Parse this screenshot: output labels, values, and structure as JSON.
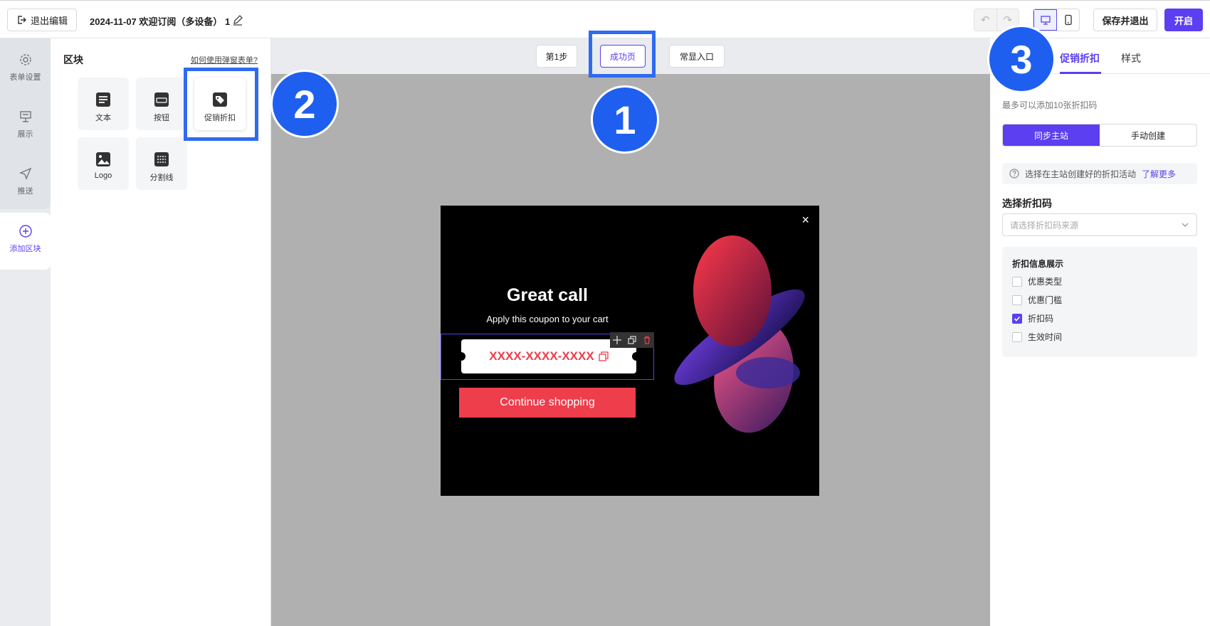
{
  "topbar": {
    "exit_label": "退出编辑",
    "doc_title": "2024-11-07 欢迎订阅（多设备） 1",
    "save_label": "保存并退出",
    "open_label": "开启"
  },
  "leftnav": {
    "items": [
      {
        "label": "表单设置",
        "icon": "gear-icon"
      },
      {
        "label": "展示",
        "icon": "presentation-icon"
      },
      {
        "label": "推送",
        "icon": "send-icon"
      },
      {
        "label": "添加区块",
        "icon": "plus-circle-icon"
      }
    ]
  },
  "blockpanel": {
    "title": "区块",
    "help_link": "如何使用弹窗表单?",
    "tiles": [
      {
        "label": "文本",
        "icon": "text-icon"
      },
      {
        "label": "按钮",
        "icon": "button-icon"
      },
      {
        "label": "促销折扣",
        "icon": "tag-icon"
      },
      {
        "label": "Logo",
        "icon": "image-icon"
      },
      {
        "label": "分割线",
        "icon": "divider-icon"
      }
    ]
  },
  "annotations": [
    "1",
    "2",
    "3"
  ],
  "steps": [
    {
      "label": "第1步"
    },
    {
      "label": "成功页"
    },
    {
      "label": "常显入口"
    }
  ],
  "popup": {
    "close": "×",
    "title": "Great call",
    "subtitle": "Apply this coupon to your cart",
    "coupon_code": "XXXX-XXXX-XXXX",
    "cta_label": "Continue shopping"
  },
  "rightpanel": {
    "tabs": [
      {
        "label": "促销折扣"
      },
      {
        "label": "样式"
      }
    ],
    "note": "最多可以添加10张折扣码",
    "segments": [
      "同步主站",
      "手动创建"
    ],
    "info_text": "选择在主站创建好的折扣活动",
    "info_link": "了解更多",
    "select_title": "选择折扣码",
    "select_placeholder": "请选择折扣码来源",
    "display_title": "折扣信息展示",
    "checkboxes": [
      {
        "label": "优惠类型",
        "checked": false
      },
      {
        "label": "优惠门槛",
        "checked": false
      },
      {
        "label": "折扣码",
        "checked": true
      },
      {
        "label": "生效时间",
        "checked": false
      }
    ]
  },
  "colors": {
    "accent": "#5b3ff0",
    "annotation": "#1f5ff0",
    "cta": "#ee3d4b"
  }
}
